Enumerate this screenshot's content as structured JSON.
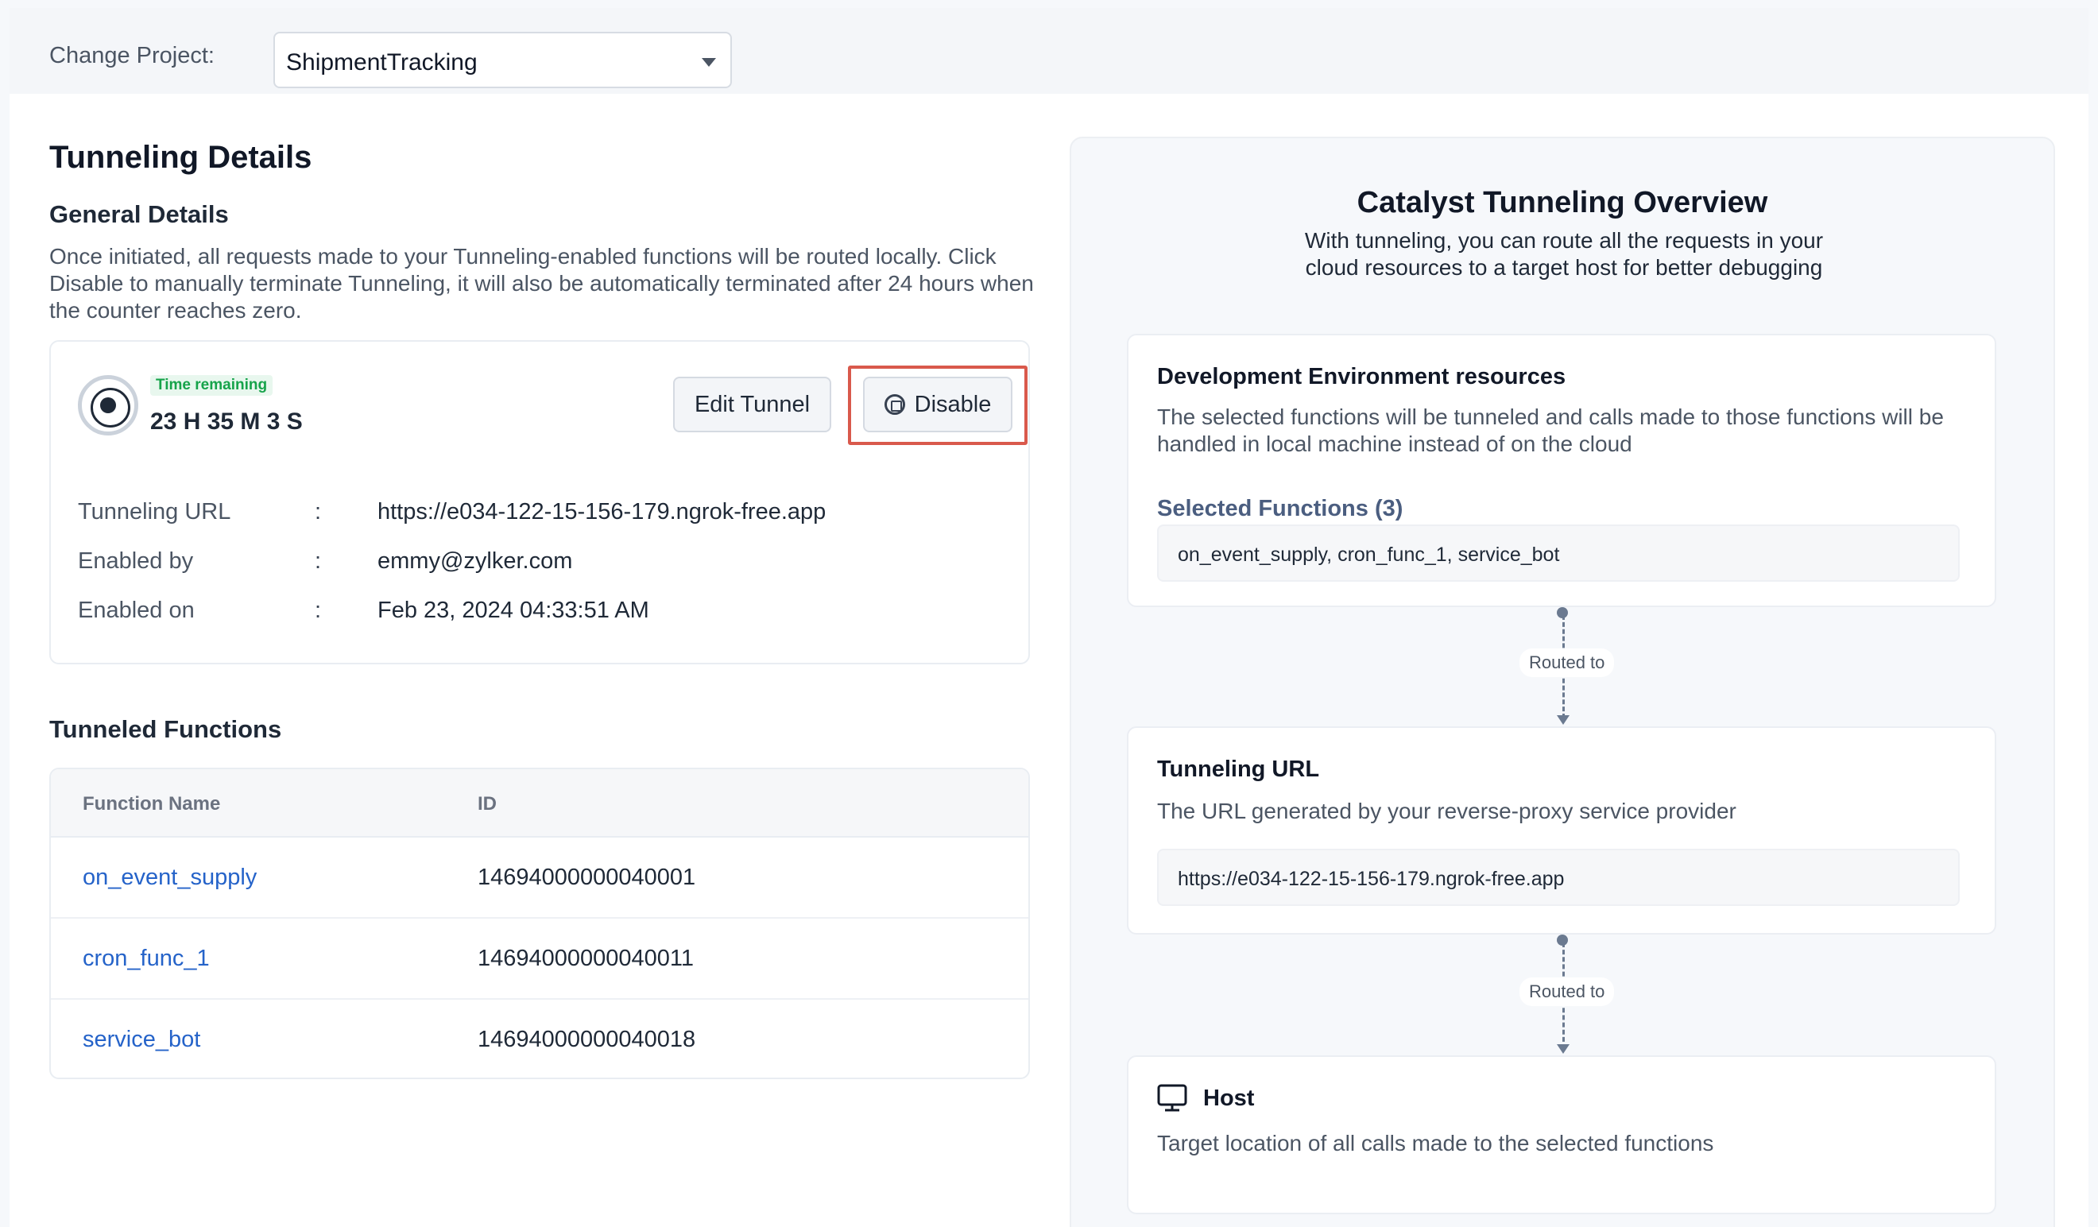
{
  "topbar": {
    "change_project_label": "Change Project:",
    "project_value": "ShipmentTracking"
  },
  "details": {
    "title": "Tunneling Details",
    "general_title": "General Details",
    "general_desc": "Once initiated, all requests made to your Tunneling-enabled functions will be routed locally. Click Disable to manually terminate Tunneling, it will also be automatically terminated after 24 hours when the counter reaches zero.",
    "time_remaining_label": "Time remaining",
    "time_remaining_value": "23 H 35 M 3 S",
    "edit_button": "Edit Tunnel",
    "disable_button": "Disable",
    "rows": [
      {
        "label": "Tunneling URL",
        "colon": ":",
        "value": "https://e034-122-15-156-179.ngrok-free.app"
      },
      {
        "label": "Enabled by",
        "colon": ":",
        "value": "emmy@zylker.com"
      },
      {
        "label": "Enabled on",
        "colon": ":",
        "value": "Feb 23, 2024 04:33:51 AM"
      }
    ]
  },
  "functions": {
    "title": "Tunneled Functions",
    "columns": [
      "Function Name",
      "ID"
    ],
    "rows": [
      {
        "name": "on_event_supply",
        "id": "14694000000040001"
      },
      {
        "name": "cron_func_1",
        "id": "14694000000040011"
      },
      {
        "name": "service_bot",
        "id": "14694000000040018"
      }
    ]
  },
  "overview": {
    "title": "Catalyst Tunneling Overview",
    "desc": "With tunneling, you can route all the requests in your cloud resources to a target host for better debugging",
    "dev_card": {
      "title": "Development Environment resources",
      "desc": "The selected functions will be tunneled and calls made to those functions will be handled in local machine instead of on the cloud",
      "selected_label": "Selected Functions  (3)",
      "selected_value": "on_event_supply, cron_func_1, service_bot"
    },
    "routed_label_1": "Routed to",
    "url_card": {
      "title": "Tunneling URL",
      "desc": "The URL generated by your reverse-proxy service provider",
      "value": "https://e034-122-15-156-179.ngrok-free.app"
    },
    "routed_label_2": "Routed to",
    "host_card": {
      "title": "Host",
      "desc": "Target location of all calls made to the selected functions"
    }
  },
  "colors": {
    "link": "#2563c9",
    "success": "#16a34a",
    "highlight": "#d9594c"
  },
  "icons": [
    "radio-timer-icon",
    "stop-circle-icon",
    "chevron-down-icon",
    "monitor-icon"
  ]
}
